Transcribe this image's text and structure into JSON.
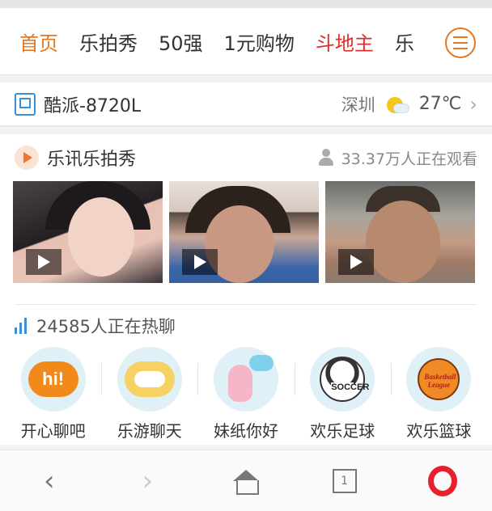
{
  "tabs": [
    "首页",
    "乐拍秀",
    "50强",
    "1元购物",
    "斗地主",
    "乐"
  ],
  "device": {
    "name": "酷派-8720L",
    "city": "深圳",
    "temperature": "27℃"
  },
  "live_section": {
    "title": "乐讯乐拍秀",
    "viewers": "33.37万人正在观看"
  },
  "videos": [
    {
      "icon": "play-icon"
    },
    {
      "icon": "play-icon"
    },
    {
      "icon": "play-icon"
    }
  ],
  "chat_section": {
    "title": "24585人正在热聊"
  },
  "rooms": [
    {
      "label": "开心聊吧",
      "icon": "hi-bubble-icon",
      "icon_text": "hi!"
    },
    {
      "label": "乐游聊天",
      "icon": "gamepad-bubble-icon"
    },
    {
      "label": "妹纸你好",
      "icon": "girl-chat-icon"
    },
    {
      "label": "欢乐足球",
      "icon": "soccer-ball-icon",
      "icon_text": "SOCCER"
    },
    {
      "label": "欢乐篮球",
      "icon": "basketball-icon",
      "icon_text": "Basketball League"
    }
  ],
  "bottom_nav": {
    "tab_count": "1"
  },
  "colors": {
    "accent": "#e8761c",
    "red": "#e02d2d",
    "link_blue": "#3a8fd6",
    "opera_red": "#e8202e"
  }
}
